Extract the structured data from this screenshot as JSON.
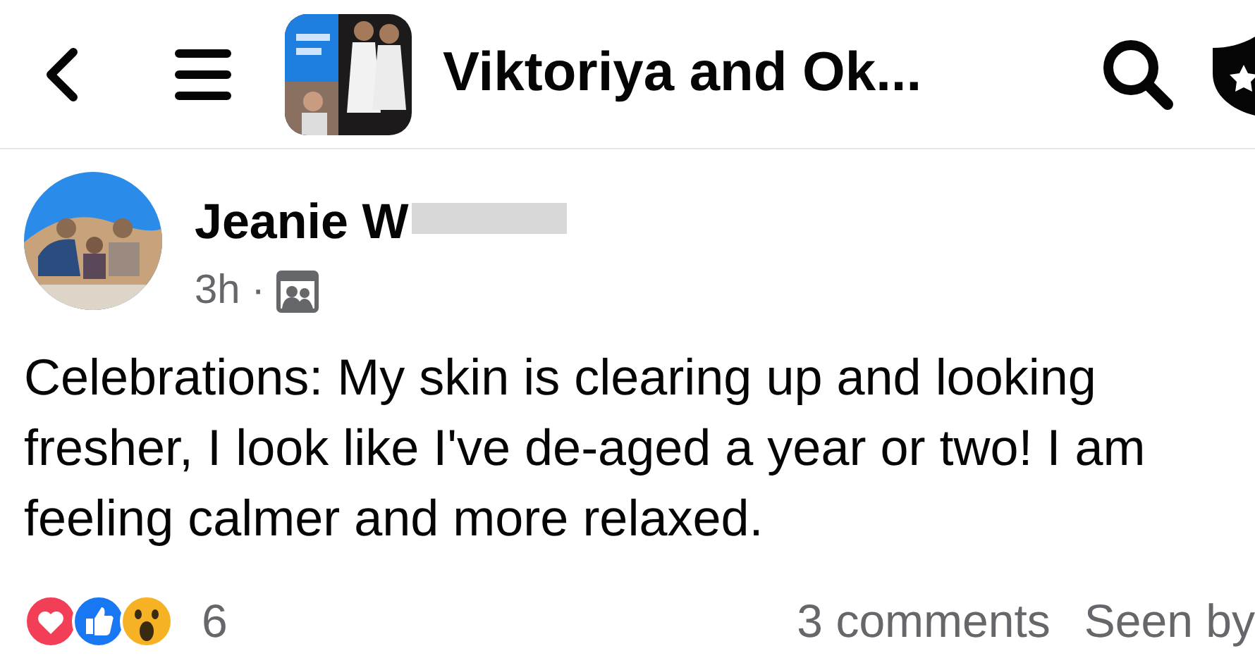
{
  "header": {
    "title": "Viktoriya and Ok..."
  },
  "post": {
    "author": "Jeanie W",
    "time": "3h",
    "separator": "·",
    "body": "Celebrations: My skin is clearing up and looking fresher, I look like I've de-aged a year or two! I am feeling calmer and more relaxed.",
    "reactions": [
      {
        "kind": "love"
      },
      {
        "kind": "like"
      },
      {
        "kind": "wow"
      }
    ],
    "reaction_count": "6",
    "comments": "3 comments",
    "seen": "Seen by"
  }
}
